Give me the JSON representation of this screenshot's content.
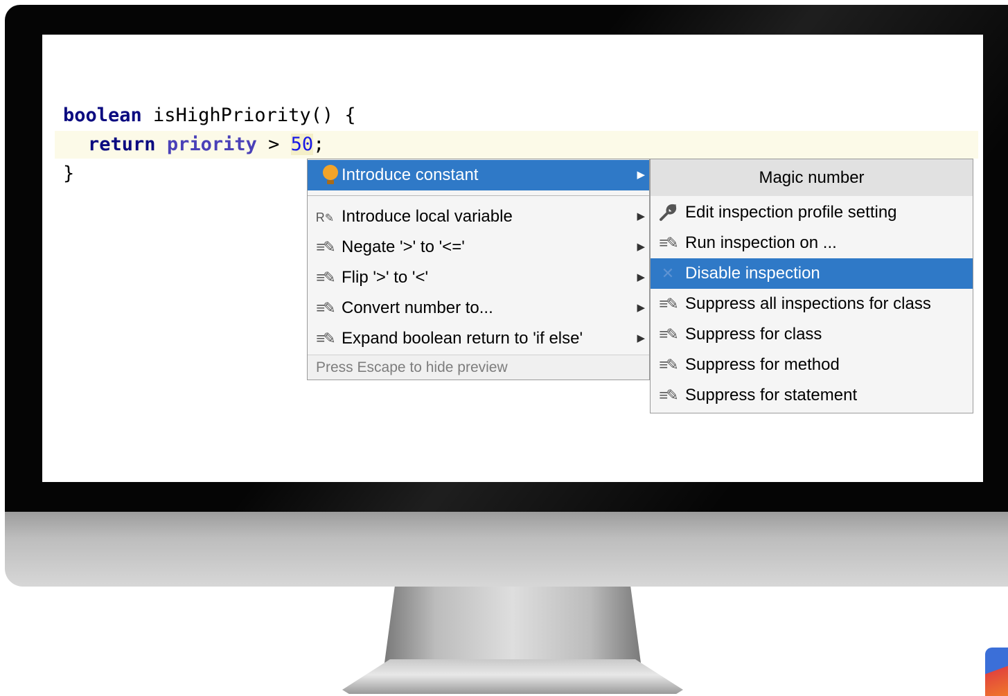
{
  "code": {
    "line1": {
      "keyword": "boolean",
      "rest": " isHighPriority() {"
    },
    "line2": {
      "keyword": "return",
      "field": "priority",
      "operator": " > ",
      "number": "50",
      "tail": ";"
    },
    "line3": {
      "text": "}"
    }
  },
  "intention_menu": {
    "items": [
      {
        "label": "Introduce constant",
        "icon": "lightbulb-icon",
        "selected": true,
        "has_submenu": true
      },
      {
        "label": "Introduce local variable",
        "icon": "refactor-icon",
        "has_submenu": true
      },
      {
        "label": "Negate '>' to '<='",
        "icon": "intention-pen-icon",
        "has_submenu": true
      },
      {
        "label": "Flip '>' to '<'",
        "icon": "intention-pen-icon",
        "has_submenu": true
      },
      {
        "label": "Convert number to...",
        "icon": "intention-pen-icon",
        "has_submenu": true
      },
      {
        "label": "Expand boolean return to 'if else'",
        "icon": "intention-pen-icon",
        "has_submenu": true
      }
    ],
    "hint": "Press Escape to hide preview"
  },
  "submenu": {
    "title": "Magic number",
    "items": [
      {
        "label": "Edit inspection profile setting",
        "icon": "wrench-icon"
      },
      {
        "label": "Run inspection on ...",
        "icon": "intention-pen-icon"
      },
      {
        "label": "Disable inspection",
        "icon": "close-icon",
        "selected": true
      },
      {
        "label": "Suppress all inspections for class",
        "icon": "intention-pen-icon"
      },
      {
        "label": "Suppress for class",
        "icon": "intention-pen-icon"
      },
      {
        "label": "Suppress for method",
        "icon": "intention-pen-icon"
      },
      {
        "label": "Suppress for statement",
        "icon": "intention-pen-icon"
      }
    ]
  },
  "colors": {
    "selection": "#2f79c7",
    "keyword": "#0b0b80",
    "field": "#4a41b8",
    "number": "#1717e6",
    "current_line": "#fcfae8"
  }
}
